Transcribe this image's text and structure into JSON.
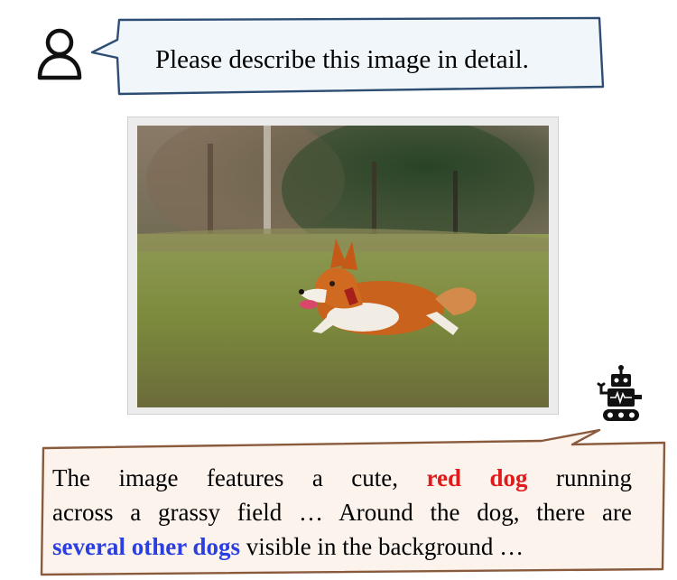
{
  "question": {
    "text": "Please describe this image in detail.",
    "user_icon": "user-icon",
    "bubble_fill": "#f1f6fb",
    "bubble_stroke": "#2d4d73"
  },
  "photo": {
    "subject_icon": "running-corgi-photo",
    "border_color": "#d4d4d4"
  },
  "answer": {
    "robot_icon": "robot-icon",
    "bubble_fill": "#fbf3ec",
    "bubble_stroke": "#8a5a3c",
    "line1_prefix": "The image features a cute,",
    "red_phrase": "red dog",
    "line1_suffix": "running",
    "line2": "across a grassy field … Around the dog, there are",
    "blue_phrase": "several other dogs",
    "line3_suffix": "visible in the background …",
    "red_color": "#e01b1b",
    "blue_color": "#2b3fe0"
  }
}
